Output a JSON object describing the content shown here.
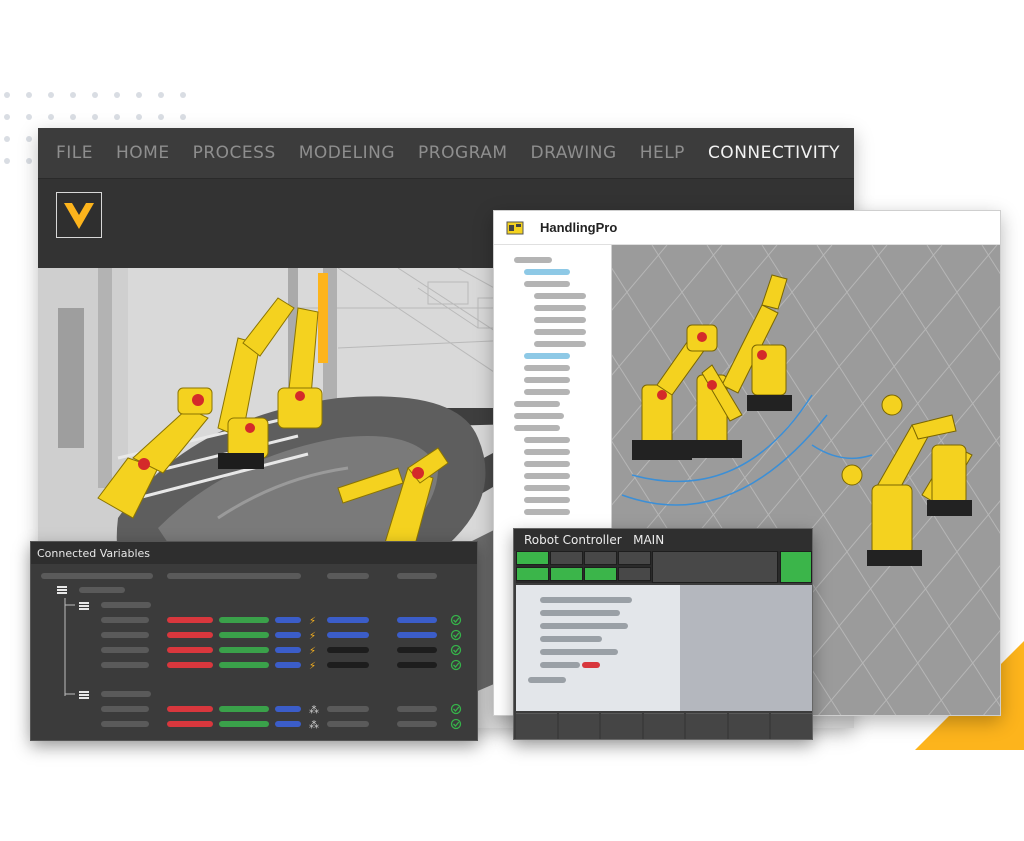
{
  "colors": {
    "accent": "#fdb41c",
    "robot_yellow": "#f4d21f",
    "menu_bg": "#3c3c3c",
    "menu_text": "#8e8e8e",
    "menu_active": "#f2f2f2",
    "status_green": "#3bb54a",
    "var_red": "#d8373d",
    "var_green": "#3aa14a",
    "var_blue": "#3b5dc9",
    "check_green": "#36b34a"
  },
  "main_window": {
    "menu": [
      {
        "label": "FILE"
      },
      {
        "label": "HOME"
      },
      {
        "label": "PROCESS"
      },
      {
        "label": "MODELING"
      },
      {
        "label": "PROGRAM"
      },
      {
        "label": "DRAWING"
      },
      {
        "label": "HELP"
      },
      {
        "label": "CONNECTIVITY",
        "active": true
      }
    ],
    "logo_icon": "v-logo-icon"
  },
  "handling_pro": {
    "title": "HandlingPro",
    "icon": "robot-app-icon"
  },
  "connected_variables": {
    "title": "Connected Variables"
  },
  "robot_controller": {
    "title": "Robot Controller   MAIN"
  }
}
